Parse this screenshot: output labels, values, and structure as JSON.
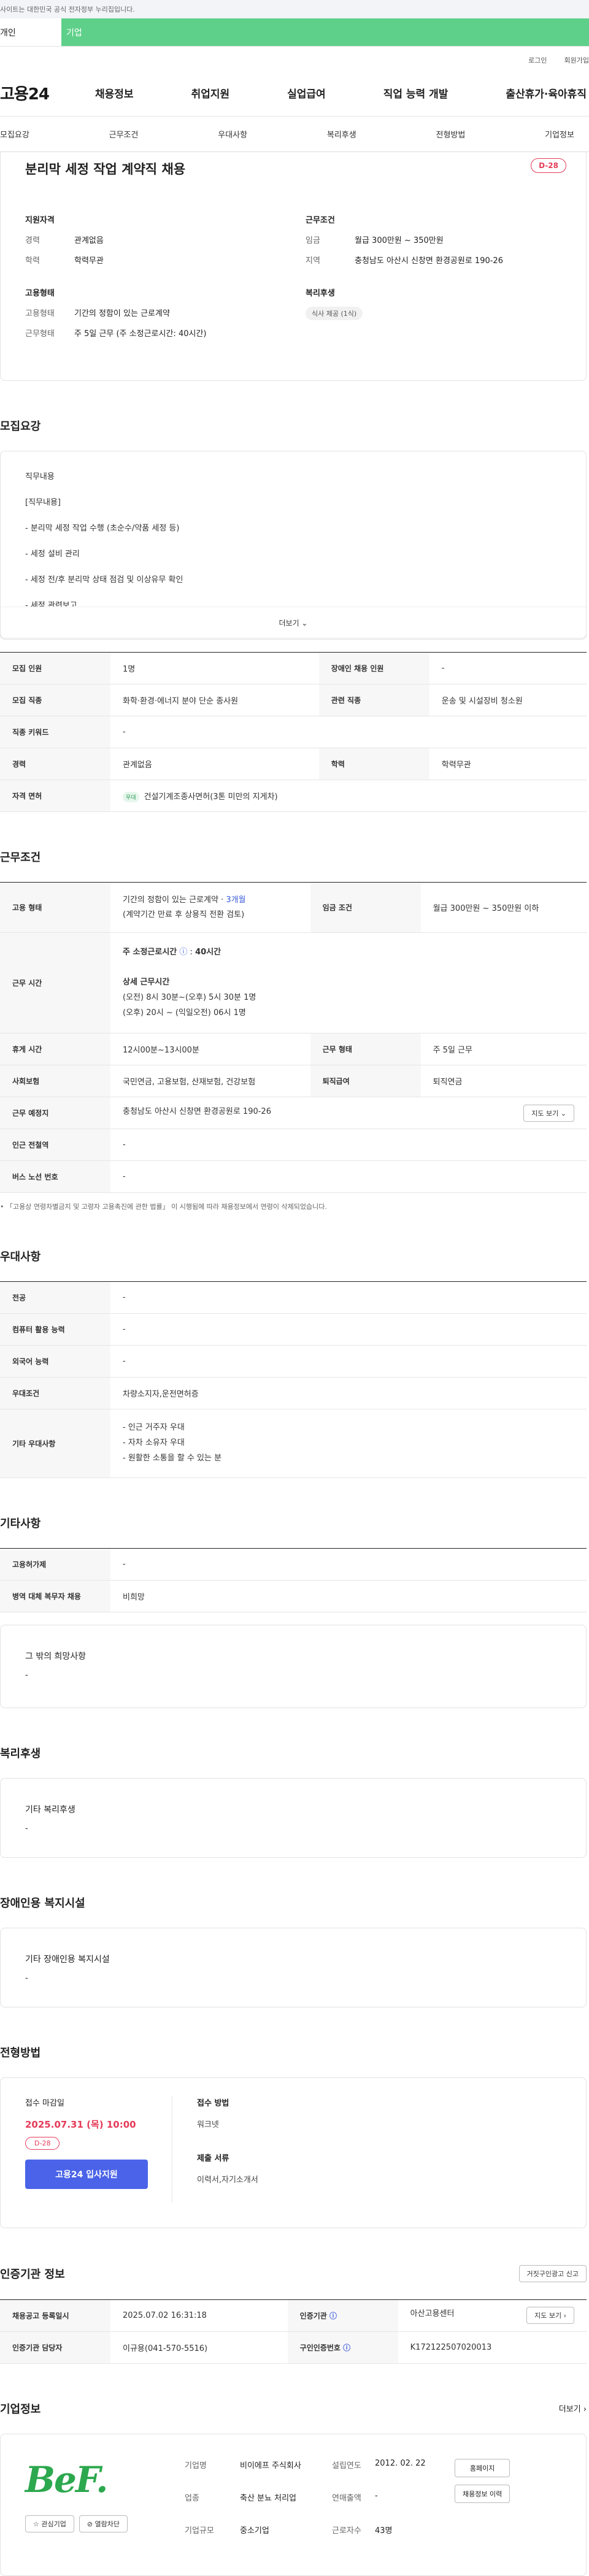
{
  "topbar": {
    "notice": "사이트는 대한민국 공식 전자정부 누리집입니다."
  },
  "user_tabs": {
    "personal": "개인",
    "company": "기업"
  },
  "util": {
    "login": "로그인",
    "join": "회원가입"
  },
  "gnb": {
    "logo": "고용24",
    "menu": [
      "채용정보",
      "취업지원",
      "실업급여",
      "직업 능력 개발",
      "출산휴가·육아휴직"
    ]
  },
  "anchors": [
    "모집요강",
    "근무조건",
    "우대사항",
    "복리후생",
    "전형방법",
    "기업정보"
  ],
  "job": {
    "title": "분리막 세정 작업 계약직 채용",
    "dday": "D-28",
    "qualification": {
      "title": "지원자격",
      "career_k": "경력",
      "career_v": "관계없음",
      "edu_k": "학력",
      "edu_v": "학력무관"
    },
    "conditions": {
      "title": "근무조건",
      "wage_k": "임금",
      "wage_v": "월급 300만원 ~ 350만원",
      "region_k": "지역",
      "region_v": "충청남도 아산시 신창면 환경공원로 190-26"
    },
    "employment": {
      "title": "고용형태",
      "type_k": "고용형태",
      "type_v": "기간의 정함이 있는 근로계약",
      "hours_k": "근무형태",
      "hours_v": "주 5일 근무 (주 소정근로시간: 40시간)"
    },
    "welfare": {
      "title": "복리후생",
      "badge": "식사 제공 (1식)"
    }
  },
  "recruit": {
    "title": "모집요강",
    "desc": [
      "직무내용",
      "[직무내용]",
      "- 분리막 세정 작업 수행 (초순수/약품 세정 등)",
      "- 세정 설비 관리",
      "- 세정 전/후 분리막 상태 점검 및 이상유무 확인",
      "- 세정 관련보고"
    ],
    "more": "더보기 ⌄",
    "rows": [
      [
        "모집 인원",
        "1명",
        "장애인 채용 인원",
        "-"
      ],
      [
        "모집 직종",
        "화학·환경·에너지 분야 단순 종사원",
        "관련 직종",
        "운송 및 시설장비 청소원"
      ],
      [
        "직종 키워드",
        "-",
        "",
        ""
      ],
      [
        "경력",
        "관계없음",
        "학력",
        "학력무관"
      ]
    ],
    "license_k": "자격 면허",
    "license_tag": "우대",
    "license_v": "건설기계조종사면허(3톤 미만의 지게차)"
  },
  "work": {
    "title": "근무조건",
    "type_k": "고용 형태",
    "type_v1": "기간의 정함이 있는 근로계약 · ",
    "type_v1b": "3개월",
    "type_v2": "(계약기간 만료 후 상용직 전환 검토)",
    "wage_k": "임금 조건",
    "wage_v": "월급 300만원 ~ 350만원 이하",
    "time_k": "근무 시간",
    "time_main": "주 소정근로시간",
    "time_hours": "40시간",
    "time_detail_t": "상세 근무시간",
    "time_d1": "(오전) 8시 30분~(오후) 5시 30분 1명",
    "time_d2": "(오후) 20시 ~ (익일오전) 06시 1명",
    "rest_k": "휴게 시간",
    "rest_v": "12시00분~13시00분",
    "form_k": "근무 형태",
    "form_v": "주 5일 근무",
    "ins_k": "사회보험",
    "ins_v": "국민연금, 고용보험, 산재보험, 건강보험",
    "ret_k": "퇴직급여",
    "ret_v": "퇴직연금",
    "place_k": "근무 예정지",
    "place_v": "충청남도 아산시 신창면 환경공원로 190-26",
    "map_btn": "지도 보기 ⌄",
    "station_k": "인근 전철역",
    "station_v": "-",
    "bus_k": "버스 노선 번호",
    "bus_v": "-",
    "note": "「고용상 연령차별금지 및 고령자 고용촉진에 관한 법률」 이 시행됨에 따라 채용정보에서 연령이 삭제되었습니다."
  },
  "pref": {
    "title": "우대사항",
    "rows": [
      [
        "전공",
        "-"
      ],
      [
        "컴퓨터 활용 능력",
        "-"
      ],
      [
        "외국어 능력",
        "-"
      ],
      [
        "우대조건",
        "차량소지자,운전면허증"
      ]
    ],
    "other_k": "기타 우대사항",
    "other_v": [
      "- 인근 거주자 우대",
      "- 자차 소유자 우대",
      "- 원활한 소통을 할 수 있는 분"
    ]
  },
  "etc": {
    "title": "기타사항",
    "rows": [
      [
        "고용허가제",
        "-"
      ],
      [
        "병역 대체 복무자 채용",
        "비희망"
      ]
    ],
    "wish_t": "그 밖의 희망사항",
    "wish_v": "-"
  },
  "benefit": {
    "title": "복리후생",
    "sub": "기타 복리후생",
    "val": "-"
  },
  "disabled": {
    "title": "장애인용 복지시설",
    "sub": "기타 장애인용 복지시설",
    "val": "-"
  },
  "apply": {
    "title": "전형방법",
    "deadline_l": "접수 마감일",
    "deadline_v": "2025.07.31 (목) 10:00",
    "dday": "D-28",
    "btn": "고용24 입사지원",
    "method_l": "접수 방법",
    "method_v": "워크넷",
    "docs_l": "제출 서류",
    "docs_v": "이력서,자기소개서"
  },
  "cert": {
    "title": "인증기관 정보",
    "report_btn": "거짓구인광고 신고",
    "reg_k": "채용공고 등록일시",
    "reg_v": "2025.07.02 16:31:18",
    "org_k": "인증기관",
    "org_v": "아산고용센터",
    "map_btn": "지도 보기 ›",
    "mgr_k": "인증기관 담당자",
    "mgr_v": "이규용(041-570-5516)",
    "num_k": "구인인증번호",
    "num_v": "K172122507020013"
  },
  "company": {
    "title": "기업정보",
    "more": "더보기 ›",
    "logo": "BeF.",
    "fav": "☆ 관심기업",
    "block": "⊘ 열람차단",
    "name_k": "기업명",
    "name_v": "비이에프 주식회사",
    "ind_k": "업종",
    "ind_v": "축산 분뇨 처리업",
    "scale_k": "기업규모",
    "scale_v": "중소기업",
    "est_k": "설립연도",
    "est_v": "2012. 02. 22",
    "sales_k": "연매출액",
    "sales_v": "-",
    "emp_k": "근로자수",
    "emp_v": "43명",
    "home_btn": "홈페이지",
    "list_btn": "채용정보 이력"
  }
}
